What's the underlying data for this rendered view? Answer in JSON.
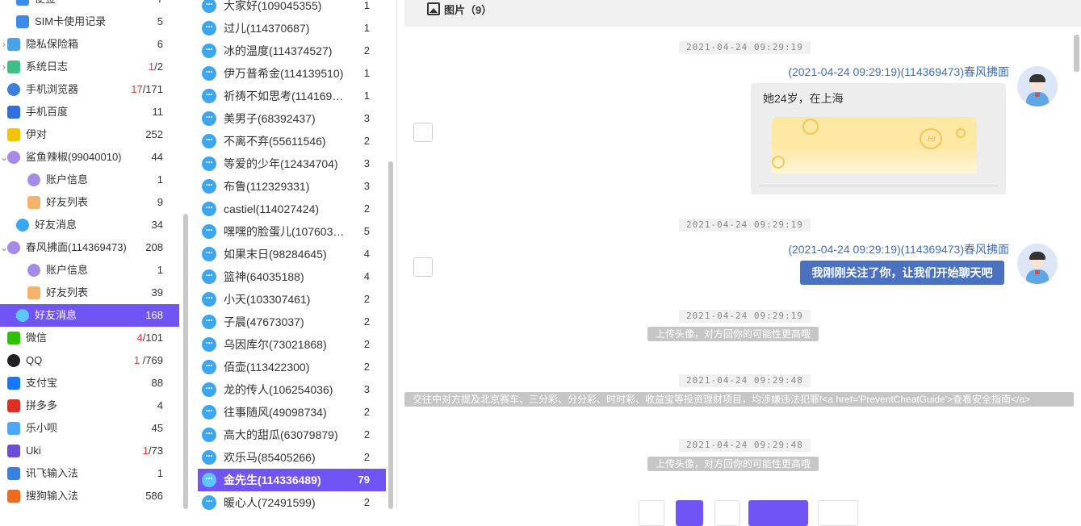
{
  "sidebar": {
    "items": [
      {
        "label": "便签",
        "count": "7",
        "icon": "note-icon",
        "color": "#3d8be8",
        "level": 1
      },
      {
        "label": "SIM卡使用记录",
        "count": "5",
        "icon": "sim-record-icon",
        "color": "#3d8be8",
        "level": 1
      },
      {
        "label": "隐私保险箱",
        "count": "6",
        "icon": "privacy-safe-icon",
        "color": "#4aa3e8",
        "level": 0,
        "chevron": true
      },
      {
        "label": "系统日志",
        "count_red": "1",
        "count": "/2",
        "icon": "system-log-icon",
        "color": "#3fbf86",
        "level": 0,
        "chevron": true
      },
      {
        "label": "手机浏览器",
        "count_red": "17",
        "count": "/171",
        "icon": "browser-icon",
        "color": "#3c7fe0",
        "level": 0
      },
      {
        "label": "手机百度",
        "count": "11",
        "icon": "baidu-paw-icon",
        "color": "#2f6fe0",
        "level": 0
      },
      {
        "label": "伊对",
        "count": "252",
        "icon": "yidui-icon",
        "color": "#f2c300",
        "level": 0
      },
      {
        "label": "鲨鱼辣椒(99040010)",
        "count": "44",
        "icon": "user-avatar-icon",
        "color": "#a48be8",
        "level": 0,
        "chevron": true,
        "expanded": true
      },
      {
        "label": "账户信息",
        "count": "1",
        "icon": "account-icon",
        "color": "#a48be8",
        "level": 2
      },
      {
        "label": "好友列表",
        "count": "9",
        "icon": "friends-list-icon",
        "color": "#f5b26b",
        "level": 2
      },
      {
        "label": "好友消息",
        "count": "34",
        "icon": "chat-bubble-icon",
        "color": "#3aa7f0",
        "level": 1,
        "chevron": true
      },
      {
        "label": "春风拂面(114369473)",
        "count": "208",
        "icon": "user-avatar-icon",
        "color": "#a48be8",
        "level": 0,
        "chevron": true,
        "expanded": true
      },
      {
        "label": "账户信息",
        "count": "1",
        "icon": "account-icon",
        "color": "#a48be8",
        "level": 2
      },
      {
        "label": "好友列表",
        "count": "39",
        "icon": "friends-list-icon",
        "color": "#f5b26b",
        "level": 2
      },
      {
        "label": "好友消息",
        "count": "168",
        "icon": "chat-bubble-icon",
        "color": "#5cc6ff",
        "level": 1,
        "chevron": true,
        "selected": true
      },
      {
        "label": "微信",
        "count_red": "4",
        "count": "/101",
        "icon": "wechat-icon",
        "color": "#2dc100",
        "level": 0
      },
      {
        "label": "QQ",
        "count_red": "1",
        "count": " /769",
        "icon": "qq-penguin-icon",
        "color": "#222222",
        "level": 0
      },
      {
        "label": "支付宝",
        "count": "88",
        "icon": "alipay-icon",
        "color": "#1677ff",
        "level": 0
      },
      {
        "label": "拼多多",
        "count": "4",
        "icon": "pinduoduo-icon",
        "color": "#e02e24",
        "level": 0
      },
      {
        "label": "乐小呗",
        "count": "45",
        "icon": "lexiaobei-icon",
        "color": "#4da6ff",
        "level": 0
      },
      {
        "label": "Uki",
        "count_red": "1",
        "count": "/73",
        "icon": "uki-icon",
        "color": "#6b4ed8",
        "level": 0
      },
      {
        "label": "讯飞输入法",
        "count": "1",
        "icon": "iflytek-icon",
        "color": "#3b7fe0",
        "level": 0
      },
      {
        "label": "搜狗输入法",
        "count": "586",
        "icon": "sogou-icon",
        "color": "#f26a1b",
        "level": 0
      }
    ]
  },
  "contacts": [
    {
      "name": "大家好(109045355)",
      "count": "1"
    },
    {
      "name": "过儿(114370687)",
      "count": "1"
    },
    {
      "name": "冰的温度(114374527)",
      "count": "2"
    },
    {
      "name": "伊万普希金(114139510)",
      "count": "1"
    },
    {
      "name": "祈祷不如思考(114169…",
      "count": "1"
    },
    {
      "name": "美男子(68392437)",
      "count": "3"
    },
    {
      "name": "不离不弃(55611546)",
      "count": "2"
    },
    {
      "name": "等爱的少年(12434704)",
      "count": "3"
    },
    {
      "name": "布鲁(112329331)",
      "count": "3"
    },
    {
      "name": "castiel(114027424)",
      "count": "2"
    },
    {
      "name": "嘿嘿的脸蛋儿(107603…",
      "count": "5"
    },
    {
      "name": "如果末日(98284645)",
      "count": "4"
    },
    {
      "name": "篮神(64035188)",
      "count": "4"
    },
    {
      "name": "小天(103307461)",
      "count": "2"
    },
    {
      "name": "子晨(47673037)",
      "count": "2"
    },
    {
      "name": "乌因库尔(73021868)",
      "count": "2"
    },
    {
      "name": "佰壶(113422300)",
      "count": "2"
    },
    {
      "name": "龙的传人(106254036)",
      "count": "3"
    },
    {
      "name": "往事随风(49098734)",
      "count": "2"
    },
    {
      "name": "高大的甜瓜(63079879)",
      "count": "2"
    },
    {
      "name": "欢乐马(85405266)",
      "count": "2"
    },
    {
      "name": "金先生(114336489)",
      "count": "79",
      "selected": true
    },
    {
      "name": "暖心人(72491599)",
      "count": "2"
    }
  ],
  "chat": {
    "tab_label": "图片（9）",
    "tab_icon": "image-icon",
    "timestamps": [
      "2021-04-24 09:29:19",
      "2021-04-24 09:29:19",
      "2021-04-24 09:29:19",
      "2021-04-24 09:29:48",
      "2021-04-24 09:29:48"
    ],
    "sender1": "(2021-04-24 09:29:19)(114369473)春风拂面",
    "message1": "她24岁，在上海",
    "sender2": "(2021-04-24 09:29:19)(114369473)春风拂面",
    "message2": "我刚刚关注了你，让我们开始聊天吧",
    "system_note1": "上传头像，对方回你的可能性更高哦",
    "warning": "交往中对方提及北京赛车、三分彩、分分彩、时时彩、收益宝等投资理财项目，均涉嫌违法犯罪!<a href='PreventCheatGuide'>查看安全指南</a>",
    "system_note2": "上传头像，对方回你的可能性更高哦",
    "image_hi": "Hi",
    "accent_color": "#7055f4",
    "sender_color": "#3f6fc3"
  }
}
